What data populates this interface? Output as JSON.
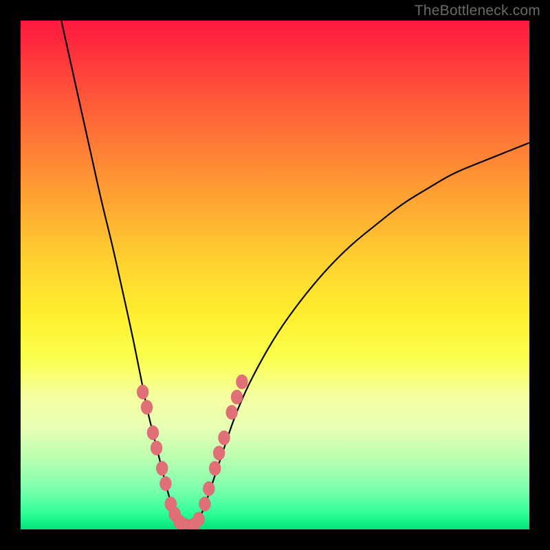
{
  "watermark": "TheBottleneck.com",
  "colors": {
    "frame": "#000000",
    "curve": "#000000",
    "dot_fill": "#e06f77",
    "dot_stroke": "#d55a63"
  },
  "chart_data": {
    "type": "line",
    "title": "",
    "xlabel": "",
    "ylabel": "",
    "xlim": [
      0,
      100
    ],
    "ylim": [
      0,
      100
    ],
    "notes": "V-shaped bottleneck curve with minimum near x≈31. Left branch descends steeply from top-left; right branch rises with diminishing slope toward top-right. Salmon dots mark the lower portion of both branches near the trough.",
    "series": [
      {
        "name": "left_branch",
        "x": [
          8,
          10,
          12,
          14,
          16,
          18,
          20,
          22,
          24,
          25,
          26,
          27,
          28,
          29,
          30,
          31,
          32,
          33
        ],
        "y": [
          100,
          91,
          82,
          73,
          64,
          56,
          47,
          38,
          28,
          23,
          19,
          15,
          11,
          7,
          4,
          2,
          1,
          0.5
        ]
      },
      {
        "name": "right_branch",
        "x": [
          33,
          34,
          35,
          36,
          37,
          38,
          40,
          42,
          45,
          50,
          55,
          60,
          65,
          70,
          75,
          80,
          85,
          90,
          95,
          100
        ],
        "y": [
          0.5,
          1,
          2,
          4,
          7,
          10,
          16,
          22,
          29,
          38,
          45,
          51,
          56,
          60,
          64,
          67,
          70,
          72,
          74,
          76
        ]
      }
    ],
    "dots": [
      {
        "x": 24.0,
        "y": 27
      },
      {
        "x": 24.8,
        "y": 24
      },
      {
        "x": 26.0,
        "y": 19
      },
      {
        "x": 26.7,
        "y": 16
      },
      {
        "x": 27.8,
        "y": 12
      },
      {
        "x": 28.5,
        "y": 9
      },
      {
        "x": 29.5,
        "y": 5
      },
      {
        "x": 30.3,
        "y": 3
      },
      {
        "x": 31.2,
        "y": 1.5
      },
      {
        "x": 32.2,
        "y": 0.8
      },
      {
        "x": 33.0,
        "y": 0.5
      },
      {
        "x": 34.0,
        "y": 0.8
      },
      {
        "x": 35.0,
        "y": 2
      },
      {
        "x": 36.2,
        "y": 5
      },
      {
        "x": 37.0,
        "y": 8
      },
      {
        "x": 38.2,
        "y": 12
      },
      {
        "x": 39.0,
        "y": 15
      },
      {
        "x": 40.0,
        "y": 18
      },
      {
        "x": 41.5,
        "y": 23
      },
      {
        "x": 42.5,
        "y": 26
      },
      {
        "x": 43.5,
        "y": 29
      }
    ]
  }
}
